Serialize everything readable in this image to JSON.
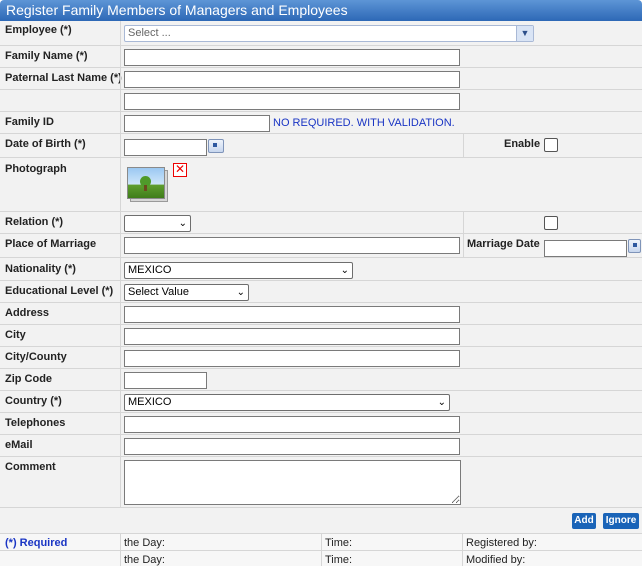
{
  "title": "Register Family Members of Managers and Employees",
  "fields": {
    "employee": {
      "label": "Employee (*)",
      "placeholder": "Select ..."
    },
    "family_name": {
      "label": "Family Name (*)",
      "value": ""
    },
    "paternal_last_name": {
      "label": "Paternal Last Name (*)",
      "value": ""
    },
    "family_id": {
      "label": "Family ID",
      "value": "",
      "hint": "NO REQUIRED. WITH VALIDATION."
    },
    "date_of_birth": {
      "label": "Date of Birth (*)",
      "value": ""
    },
    "enable": {
      "label": "Enable",
      "checked": false
    },
    "photograph": {
      "label": "Photograph"
    },
    "relation": {
      "label": "Relation (*)",
      "selected": ""
    },
    "place_of_marriage": {
      "label": "Place of Marriage",
      "value": ""
    },
    "marriage_date": {
      "label": "Marriage Date",
      "value": ""
    },
    "nationality": {
      "label": "Nationality (*)",
      "selected": "MEXICO"
    },
    "educational_level": {
      "label": "Educational Level (*)",
      "selected": "Select Value"
    },
    "address": {
      "label": "Address",
      "value": ""
    },
    "city": {
      "label": "City",
      "value": ""
    },
    "city_county": {
      "label": "City/County",
      "value": ""
    },
    "zip_code": {
      "label": "Zip Code",
      "value": ""
    },
    "country": {
      "label": "Country (*)",
      "selected": "MEXICO"
    },
    "telephones": {
      "label": "Telephones",
      "value": ""
    },
    "email": {
      "label": "eMail",
      "value": ""
    },
    "comment": {
      "label": "Comment",
      "value": ""
    }
  },
  "buttons": {
    "add": "Add",
    "ignore": "Ignore"
  },
  "footer": {
    "required": "(*) Required",
    "the_day_1": "the Day:",
    "the_day_2": "the Day:",
    "time_1": "Time:",
    "time_2": "Time:",
    "registered_by": "Registered by:",
    "modified_by": "Modified by:"
  }
}
